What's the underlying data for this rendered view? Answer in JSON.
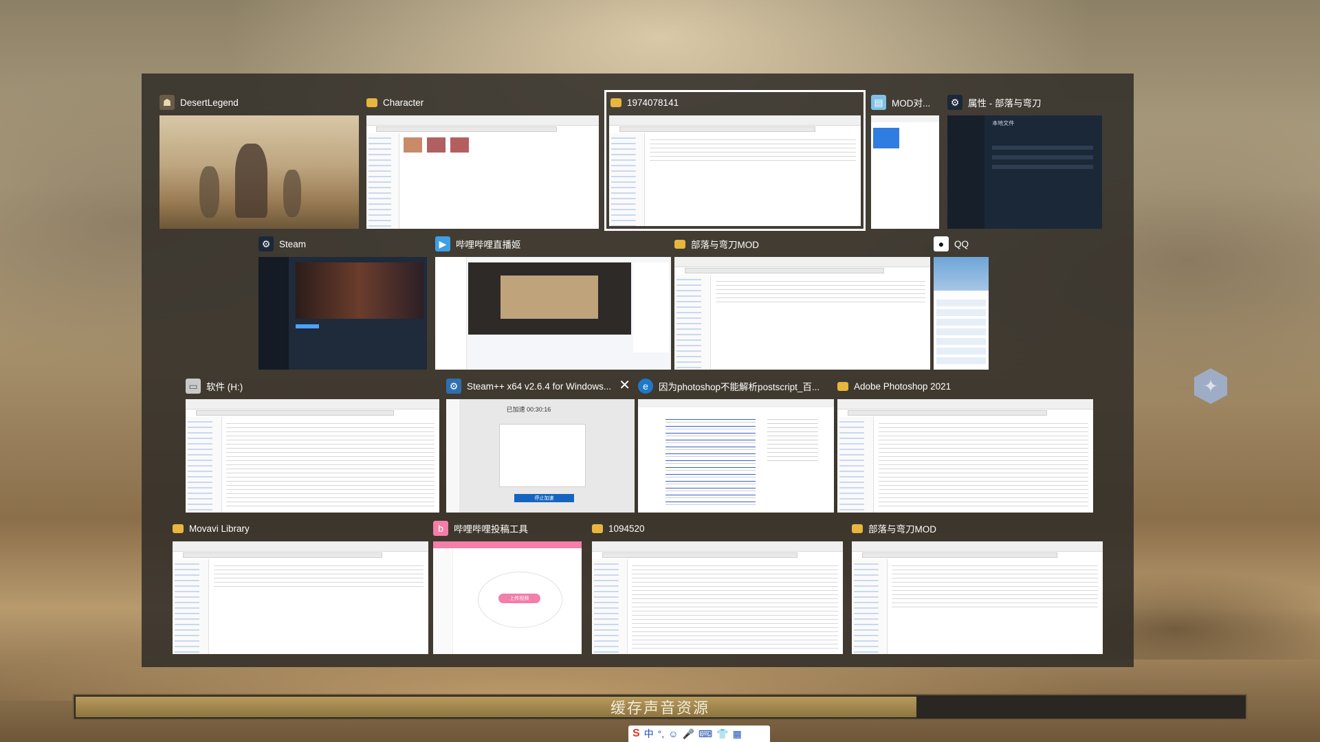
{
  "windows": [
    {
      "id": "w1",
      "title": "DesertLegend",
      "icon": "game-icon",
      "thumb": "game"
    },
    {
      "id": "w2",
      "title": "Character",
      "icon": "folder-icon",
      "thumb": "explorer"
    },
    {
      "id": "w3",
      "title": "1974078141",
      "icon": "folder-icon",
      "thumb": "explorer",
      "selected": true
    },
    {
      "id": "w4",
      "title": "MOD对...",
      "icon": "notepad-icon",
      "thumb": "editor"
    },
    {
      "id": "w5",
      "title": "属性 - 部落与弯刀",
      "icon": "steam-icon",
      "thumb": "steam-props",
      "thumb_text": "本地文件"
    },
    {
      "id": "w6",
      "title": "Steam",
      "icon": "steam-icon",
      "thumb": "steam"
    },
    {
      "id": "w7",
      "title": "哔哩哔哩直播姬",
      "icon": "bilibili-live-icon",
      "thumb": "live"
    },
    {
      "id": "w8",
      "title": "部落与弯刀MOD",
      "icon": "folder-icon",
      "thumb": "explorer"
    },
    {
      "id": "w9",
      "title": "QQ",
      "icon": "qq-icon",
      "thumb": "qq"
    },
    {
      "id": "w10",
      "title": "软件 (H:)",
      "icon": "drive-icon",
      "thumb": "explorer"
    },
    {
      "id": "w11",
      "title": "Steam++ x64 v2.6.4 for Windows...",
      "icon": "steampp-icon",
      "thumb": "steampp",
      "close": "✕",
      "thumb_text": "已加速 00:30:16",
      "thumb_button": "停止加速"
    },
    {
      "id": "w12",
      "title": "因为photoshop不能解析postscript_百...",
      "icon": "edge-icon",
      "thumb": "browser"
    },
    {
      "id": "w13",
      "title": "Adobe Photoshop 2021",
      "icon": "folder-icon",
      "thumb": "explorer"
    },
    {
      "id": "w14",
      "title": "Movavi Library",
      "icon": "folder-icon",
      "thumb": "explorer"
    },
    {
      "id": "w15",
      "title": "哔哩哔哩投稿工具",
      "icon": "bilibili-upload-icon",
      "thumb": "upload",
      "thumb_button": "上传视频"
    },
    {
      "id": "w16",
      "title": "1094520",
      "icon": "folder-icon",
      "thumb": "explorer"
    },
    {
      "id": "w17",
      "title": "部落与弯刀MOD",
      "icon": "folder-icon",
      "thumb": "explorer"
    }
  ],
  "loading": {
    "text": "缓存声音资源",
    "progress": 0.72
  },
  "ime": {
    "logo": "S",
    "mode": "中",
    "punct": "°,",
    "items": [
      "☺",
      "🎤",
      "⌨",
      "👕",
      "▦"
    ]
  },
  "colors": {
    "panel": "#302c28",
    "accent_folder": "#e8b53e",
    "bilibili_pink": "#f37ea8"
  }
}
